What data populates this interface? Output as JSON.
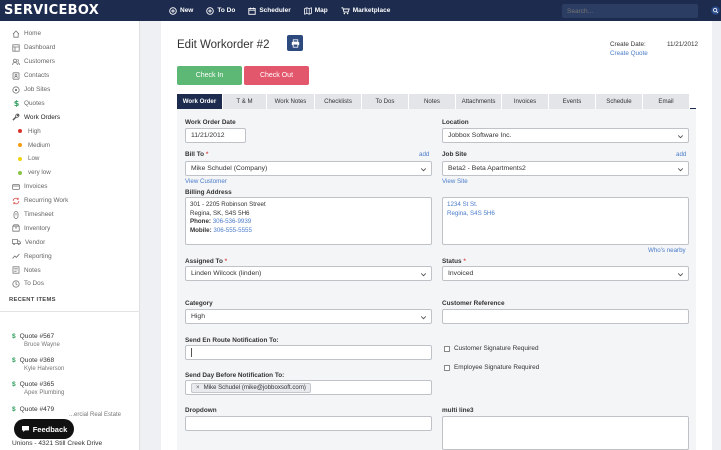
{
  "app": {
    "logo": "SERVICEBOX",
    "nav": [
      {
        "label": "New",
        "icon": "plus-circle-icon"
      },
      {
        "label": "To Do",
        "icon": "plus-circle-icon"
      },
      {
        "label": "Scheduler",
        "icon": "calendar-icon"
      },
      {
        "label": "Map",
        "icon": "map-icon"
      },
      {
        "label": "Marketplace",
        "icon": "cart-icon"
      }
    ],
    "search_placeholder": "Search..."
  },
  "sidebar": {
    "items": [
      {
        "label": "Home",
        "icon": "home-icon"
      },
      {
        "label": "Dashboard",
        "icon": "dashboard-icon"
      },
      {
        "label": "Customers",
        "icon": "users-icon"
      },
      {
        "label": "Contacts",
        "icon": "contacts-icon"
      },
      {
        "label": "Job Sites",
        "icon": "location-icon"
      },
      {
        "label": "Quotes",
        "icon": "dollar-icon"
      },
      {
        "label": "Work Orders",
        "icon": "wrench-icon"
      }
    ],
    "priorities": [
      {
        "label": "High",
        "color": "#d9342b"
      },
      {
        "label": "Medium",
        "color": "#f39c12"
      },
      {
        "label": "Low",
        "color": "#f1d40f"
      },
      {
        "label": "very low",
        "color": "#8bc34a"
      }
    ],
    "items2": [
      {
        "label": "Invoices",
        "icon": "invoice-icon"
      },
      {
        "label": "Recurring Work",
        "icon": "recurring-icon"
      },
      {
        "label": "Timesheet",
        "icon": "timesheet-icon"
      },
      {
        "label": "Inventory",
        "icon": "inventory-icon"
      },
      {
        "label": "Vendor",
        "icon": "truck-icon"
      },
      {
        "label": "Reporting",
        "icon": "chart-icon"
      },
      {
        "label": "Notes",
        "icon": "notes-icon"
      },
      {
        "label": "To Dos",
        "icon": "clock-icon"
      }
    ],
    "recent_title": "RECENT ITEMS",
    "recent": [
      {
        "title": "Quote #567",
        "sub": "Bruce Wayne"
      },
      {
        "title": "Quote #368",
        "sub": "Kyle Halverson"
      },
      {
        "title": "Quote #365",
        "sub": "Apex Plumbing"
      },
      {
        "title": "Quote #479",
        "sub": "...ercial Real Estate"
      }
    ],
    "feedback_label": "Feedback",
    "last_item": "Unions - 4321 Still Creek Drive"
  },
  "page": {
    "title": "Edit Workorder #2",
    "create_date_label": "Create Date:",
    "create_date_value": "11/21/2012",
    "create_quote": "Create Quote",
    "check_in": "Check In",
    "check_out": "Check Out",
    "tabs": [
      "Work Order",
      "T & M",
      "Work Notes",
      "Checklists",
      "To Dos",
      "Notes",
      "Attachments",
      "Invoices",
      "Events",
      "Schedule",
      "Email"
    ]
  },
  "form": {
    "work_order_date_label": "Work Order Date",
    "work_order_date": "11/21/2012",
    "location_label": "Location",
    "location": "Jobbox Software Inc.",
    "bill_to_label": "Bill To",
    "bill_to": "Mike Schudel (Company)",
    "add": "add",
    "view_customer": "View Customer",
    "job_site_label": "Job Site",
    "job_site": "Beta2 - Beta Apartments2",
    "view_site": "View Site",
    "billing_address_label": "Billing Address",
    "billing_line1": "301 - 2205 Robinson Street",
    "billing_line2": "Regina, SK, S4S 5H6",
    "phone_label": "Phone:",
    "phone": "306-536-9939",
    "mobile_label": "Mobile:",
    "mobile": "306-555-5555",
    "site_line1": "1234 St St.",
    "site_line2": "Regina, S4S 5H6",
    "whos_nearby": "Who's nearby",
    "assigned_to_label": "Assigned To",
    "assigned_to": "Linden Wilcock (linden)",
    "status_label": "Status",
    "status": "Invoiced",
    "category_label": "Category",
    "category": "High",
    "customer_ref_label": "Customer Reference",
    "customer_ref": "",
    "en_route_label": "Send En Route Notification To:",
    "customer_sig": "Customer Signature Required",
    "employee_sig": "Employee Signature Required",
    "day_before_label": "Send Day Before Notification To:",
    "day_before_tag": "Mike Schudel (mike@jobboxsoft.com)",
    "dropdown_label": "Dropdown",
    "multiline_label": "multi line3"
  }
}
